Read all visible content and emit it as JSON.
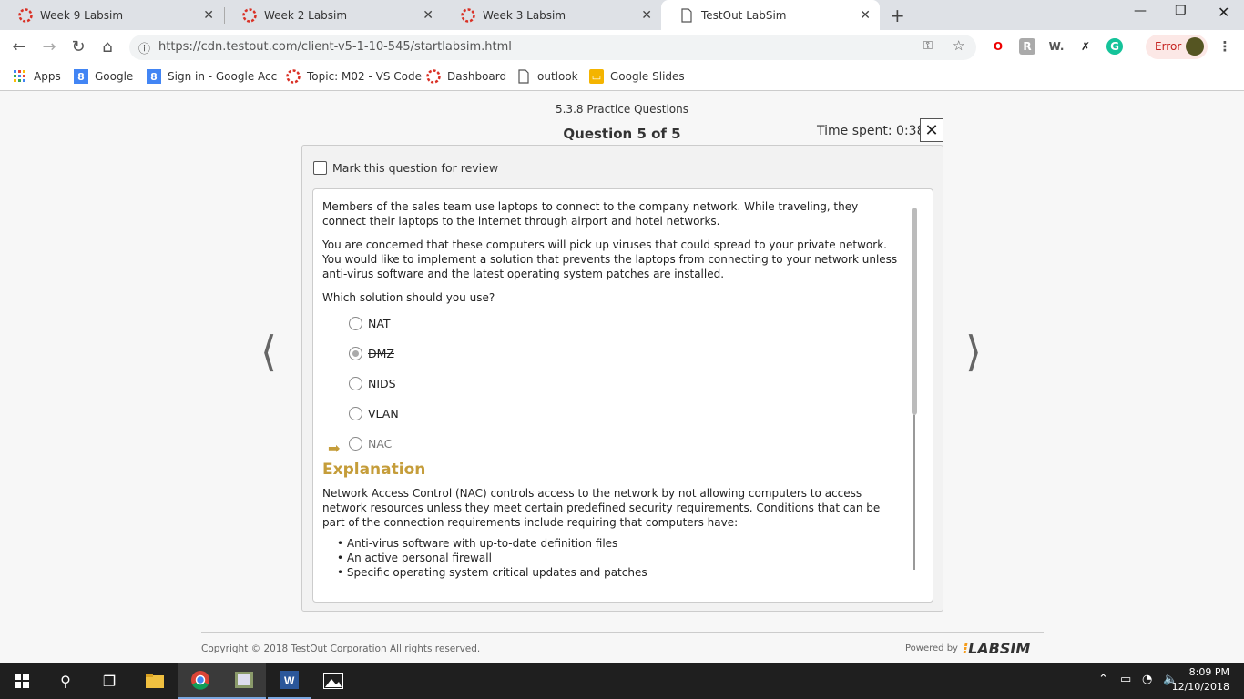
{
  "browser": {
    "tabs": [
      {
        "label": "Week 9 Labsim",
        "icon": "labsim-icon"
      },
      {
        "label": "Week 2 Labsim",
        "icon": "labsim-icon"
      },
      {
        "label": "Week 3 Labsim",
        "icon": "labsim-icon"
      },
      {
        "label": "TestOut LabSim",
        "icon": "page-icon"
      }
    ],
    "url": "https://cdn.testout.com/client-v5-1-10-545/startlabsim.html",
    "error_label": "Error",
    "bookmarks": [
      "Apps",
      "Google",
      "Sign in - Google Acc",
      "Topic: M02 - VS Code",
      "Dashboard",
      "outlook",
      "Google Slides"
    ]
  },
  "quiz": {
    "section": "5.3.8 Practice Questions",
    "question_number": "Question 5 of 5",
    "time_spent": "Time spent: 0:38",
    "mark_review": "Mark this question for review",
    "paragraphs": [
      "Members of the sales team use laptops to connect to the company network. While traveling, they connect their laptops to the internet through airport and hotel networks.",
      "You are concerned that these computers will pick up viruses that could spread to your private network. You would like to implement a solution that prevents the laptops from connecting to your network unless anti-virus software and the latest operating system patches are installed.",
      "Which solution should you use?"
    ],
    "options": [
      "NAT",
      "DMZ",
      "NIDS",
      "VLAN",
      "NAC"
    ],
    "selected_option": "DMZ",
    "correct_option": "NAC",
    "explanation_title": "Explanation",
    "explanation": "Network Access Control (NAC) controls access to the network by not allowing computers to access network resources unless they meet certain predefined security requirements. Conditions that can be part of the connection requirements include requiring that computers have:",
    "bullets": [
      "Anti-virus software with up-to-date definition files",
      "An active personal firewall",
      "Specific operating system critical updates and patches"
    ]
  },
  "footer": {
    "copyright": "Copyright © 2018 TestOut Corporation All rights reserved.",
    "powered_by": "Powered by",
    "logo": "LABSIM"
  },
  "taskbar": {
    "time": "8:09 PM",
    "date": "12/10/2018"
  },
  "colors": {
    "accent": "#c59d3a",
    "chrome_tabbar": "#dee1e6"
  }
}
